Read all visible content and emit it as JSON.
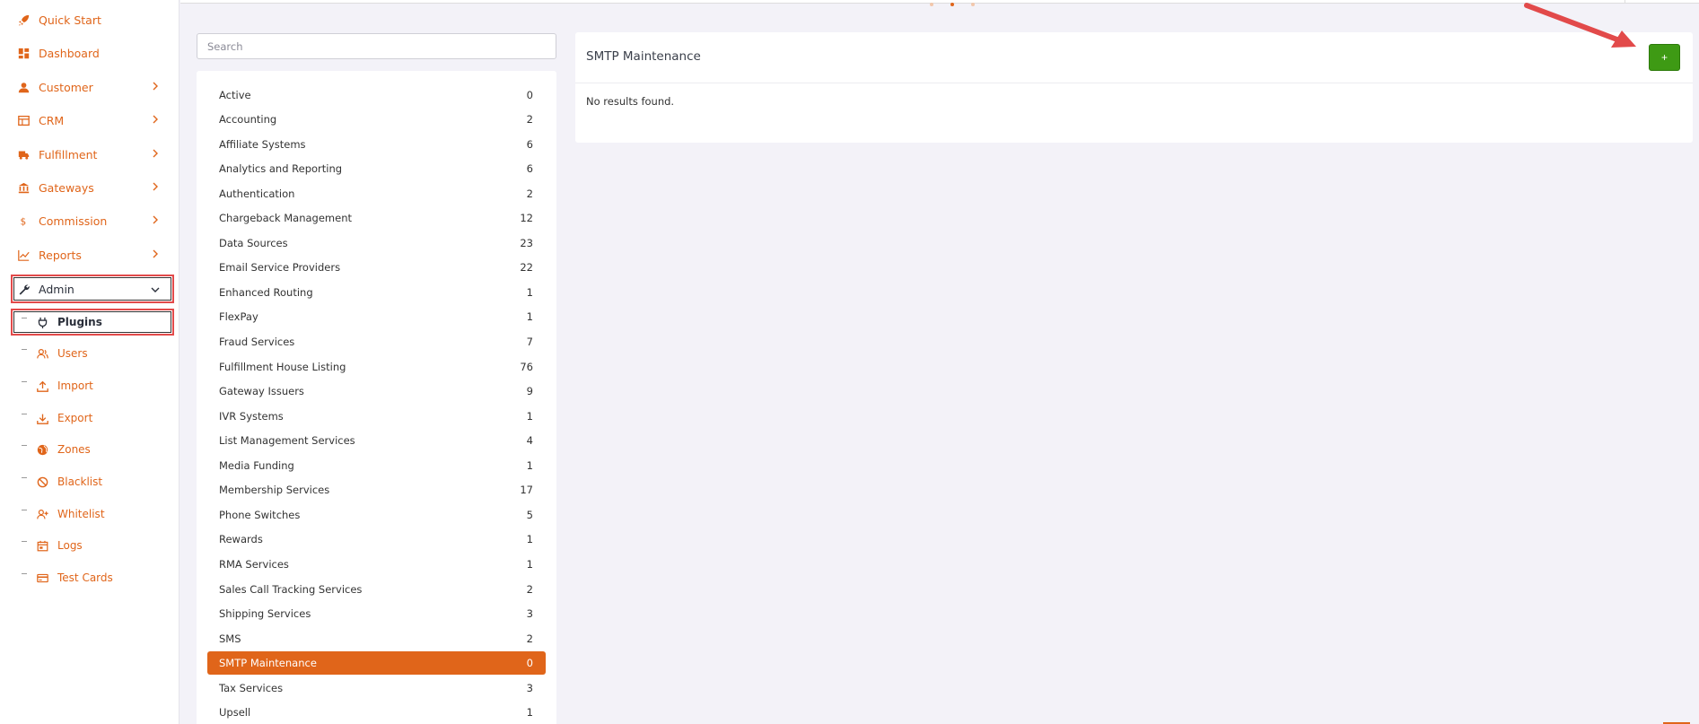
{
  "sidebar": {
    "items": [
      {
        "label": "Quick Start",
        "icon": "rocket-icon"
      },
      {
        "label": "Dashboard",
        "icon": "dashboard-icon"
      },
      {
        "label": "Customer",
        "icon": "user-icon"
      },
      {
        "label": "CRM",
        "icon": "table-icon"
      },
      {
        "label": "Fulfillment",
        "icon": "truck-icon"
      },
      {
        "label": "Gateways",
        "icon": "bank-icon"
      },
      {
        "label": "Commission",
        "icon": "dollar-icon"
      },
      {
        "label": "Reports",
        "icon": "chart-icon"
      },
      {
        "label": "Admin",
        "icon": "wrench-icon"
      }
    ],
    "admin_sub": [
      {
        "label": "Plugins",
        "icon": "plug-icon"
      },
      {
        "label": "Users",
        "icon": "users-icon"
      },
      {
        "label": "Import",
        "icon": "upload-icon"
      },
      {
        "label": "Export",
        "icon": "download-icon"
      },
      {
        "label": "Zones",
        "icon": "globe-icon"
      },
      {
        "label": "Blacklist",
        "icon": "ban-icon"
      },
      {
        "label": "Whitelist",
        "icon": "user-plus-icon"
      },
      {
        "label": "Logs",
        "icon": "calendar-icon"
      },
      {
        "label": "Test Cards",
        "icon": "credit-card-icon"
      }
    ]
  },
  "search": {
    "placeholder": "Search"
  },
  "categories": [
    {
      "name": "Active",
      "count": "0"
    },
    {
      "name": "Accounting",
      "count": "2"
    },
    {
      "name": "Affiliate Systems",
      "count": "6"
    },
    {
      "name": "Analytics and Reporting",
      "count": "6"
    },
    {
      "name": "Authentication",
      "count": "2"
    },
    {
      "name": "Chargeback Management",
      "count": "12"
    },
    {
      "name": "Data Sources",
      "count": "23"
    },
    {
      "name": "Email Service Providers",
      "count": "22"
    },
    {
      "name": "Enhanced Routing",
      "count": "1"
    },
    {
      "name": "FlexPay",
      "count": "1"
    },
    {
      "name": "Fraud Services",
      "count": "7"
    },
    {
      "name": "Fulfillment House Listing",
      "count": "76"
    },
    {
      "name": "Gateway Issuers",
      "count": "9"
    },
    {
      "name": "IVR Systems",
      "count": "1"
    },
    {
      "name": "List Management Services",
      "count": "4"
    },
    {
      "name": "Media Funding",
      "count": "1"
    },
    {
      "name": "Membership Services",
      "count": "17"
    },
    {
      "name": "Phone Switches",
      "count": "5"
    },
    {
      "name": "Rewards",
      "count": "1"
    },
    {
      "name": "RMA Services",
      "count": "1"
    },
    {
      "name": "Sales Call Tracking Services",
      "count": "2"
    },
    {
      "name": "Shipping Services",
      "count": "3"
    },
    {
      "name": "SMS",
      "count": "2"
    },
    {
      "name": "SMTP Maintenance",
      "count": "0",
      "active": true
    },
    {
      "name": "Tax Services",
      "count": "3"
    },
    {
      "name": "Upsell",
      "count": "1"
    }
  ],
  "main": {
    "title": "SMTP Maintenance",
    "empty_message": "No results found.",
    "add_label": "+"
  },
  "colors": {
    "accent": "#e0651a",
    "add_button": "#3e9a14",
    "highlight_box": "#e24a4a"
  }
}
